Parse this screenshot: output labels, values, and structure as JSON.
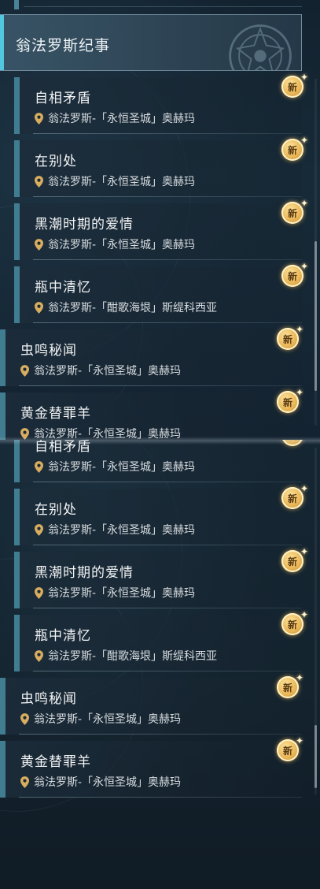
{
  "category": {
    "title": "翁法罗斯纪事"
  },
  "badge_label": "新",
  "quests_top": [
    {
      "name": "自相矛盾",
      "location": "翁法罗斯-「永恒圣城」奥赫玛"
    },
    {
      "name": "在别处",
      "location": "翁法罗斯-「永恒圣城」奥赫玛"
    },
    {
      "name": "黑潮时期的爱情",
      "location": "翁法罗斯-「永恒圣城」奥赫玛"
    },
    {
      "name": "瓶中清忆",
      "location": "翁法罗斯-「酣歌海垠」斯缇科西亚"
    },
    {
      "name": "虫鸣秘闻",
      "location": "翁法罗斯-「永恒圣城」奥赫玛"
    },
    {
      "name": "黄金替罪羊",
      "location": "翁法罗斯-「永恒圣城」奥赫玛"
    }
  ],
  "quests_bottom": [
    {
      "name": "自相矛盾",
      "location": "翁法罗斯-「永恒圣城」奥赫玛"
    },
    {
      "name": "在别处",
      "location": "翁法罗斯-「永恒圣城」奥赫玛"
    },
    {
      "name": "黑潮时期的爱情",
      "location": "翁法罗斯-「永恒圣城」奥赫玛"
    },
    {
      "name": "瓶中清忆",
      "location": "翁法罗斯-「酣歌海垠」斯缇科西亚"
    },
    {
      "name": "虫鸣秘闻",
      "location": "翁法罗斯-「永恒圣城」奥赫玛"
    },
    {
      "name": "黄金替罪羊",
      "location": "翁法罗斯-「永恒圣城」奥赫玛"
    }
  ],
  "colors": {
    "accent": "#52c8e0",
    "item_bar": "#417d90",
    "badge_gold": "#e9b555",
    "pin_gold": "#d9ad5f"
  },
  "icons": {
    "location": "map-pin-icon",
    "new": "new-badge-icon",
    "emblem": "faction-emblem-icon"
  }
}
